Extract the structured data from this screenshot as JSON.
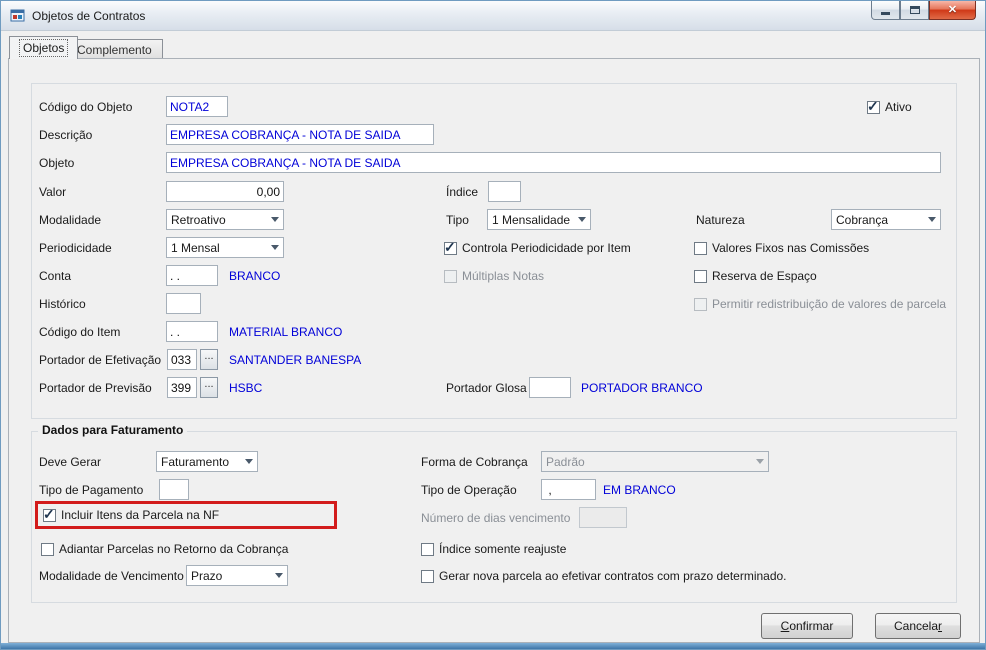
{
  "window": {
    "title": "Objetos de Contratos"
  },
  "tabs": {
    "objetos": "Objetos",
    "complemento": "Complemento"
  },
  "objetos": {
    "codigo_objeto": {
      "label": "Código do Objeto",
      "value": "NOTA2"
    },
    "ativo": {
      "label": "Ativo",
      "checked": true
    },
    "descricao": {
      "label": "Descrição",
      "value": "EMPRESA COBRANÇA - NOTA DE SAIDA"
    },
    "objeto": {
      "label": "Objeto",
      "value": "EMPRESA COBRANÇA - NOTA DE SAIDA"
    },
    "valor": {
      "label": "Valor",
      "value": "0,00"
    },
    "indice": {
      "label": "Índice",
      "value": ""
    },
    "modalidade": {
      "label": "Modalidade",
      "value": "Retroativo"
    },
    "tipo": {
      "label": "Tipo",
      "value": "1 Mensalidade"
    },
    "natureza": {
      "label": "Natureza",
      "value": "Cobrança"
    },
    "periodicidade": {
      "label": "Periodicidade",
      "value": "1 Mensal"
    },
    "controla_periodicidade": {
      "label": "Controla Periodicidade por Item",
      "checked": true
    },
    "valores_fixos": {
      "label": "Valores Fixos nas Comissões",
      "checked": false
    },
    "conta": {
      "label": "Conta",
      "value": ". .",
      "hint": "BRANCO"
    },
    "multiplas_notas": {
      "label": "Múltiplas Notas",
      "checked": false,
      "disabled": true
    },
    "reserva_espaco": {
      "label": "Reserva de Espaço",
      "checked": false
    },
    "historico": {
      "label": "Histórico",
      "value": ""
    },
    "permitir_redistribuicao": {
      "label": "Permitir redistribuição de valores de parcela",
      "checked": false,
      "disabled": true
    },
    "codigo_item": {
      "label": "Código do Item",
      "value": ". .",
      "hint": "MATERIAL BRANCO"
    },
    "portador_efetivacao": {
      "label": "Portador de Efetivação",
      "value": "033",
      "browse": "...",
      "hint": "SANTANDER BANESPA"
    },
    "portador_previsao": {
      "label": "Portador de Previsão",
      "value": "399",
      "browse": "...",
      "hint": "HSBC"
    },
    "portador_glosa": {
      "label": "Portador Glosa",
      "value": "",
      "hint": "PORTADOR BRANCO"
    }
  },
  "faturamento": {
    "title": "Dados para Faturamento",
    "deve_gerar": {
      "label": "Deve Gerar",
      "value": "Faturamento"
    },
    "forma_cobranca": {
      "label": "Forma de Cobrança",
      "value": "Padrão",
      "disabled": true
    },
    "tipo_pagamento": {
      "label": "Tipo de Pagamento",
      "value": ""
    },
    "tipo_operacao": {
      "label": "Tipo de Operação",
      "value": " , ",
      "hint": "EM BRANCO"
    },
    "incluir_itens": {
      "label": "Incluir Itens da Parcela na NF",
      "checked": true,
      "highlighted": true
    },
    "numero_dias": {
      "label": "Número de dias vencimento",
      "value": "",
      "disabled": true
    },
    "adiantar_parcelas": {
      "label": "Adiantar Parcelas no Retorno da Cobrança",
      "checked": false
    },
    "indice_reajuste": {
      "label": "Índice somente reajuste",
      "checked": false
    },
    "modalidade_vencimento": {
      "label": "Modalidade de Vencimento",
      "value": "Prazo"
    },
    "gerar_nova_parcela": {
      "label": "Gerar nova parcela ao efetivar contratos com prazo determinado.",
      "checked": false
    }
  },
  "buttons": {
    "confirmar": {
      "pre": "",
      "key": "C",
      "post": "onfirmar"
    },
    "cancelar": {
      "pre": "Cancela",
      "key": "r",
      "post": ""
    }
  },
  "colors": {
    "value_blue": "#0000d8",
    "highlight_red": "#d21b1b",
    "titlebar_close_red": "#cf3817"
  }
}
